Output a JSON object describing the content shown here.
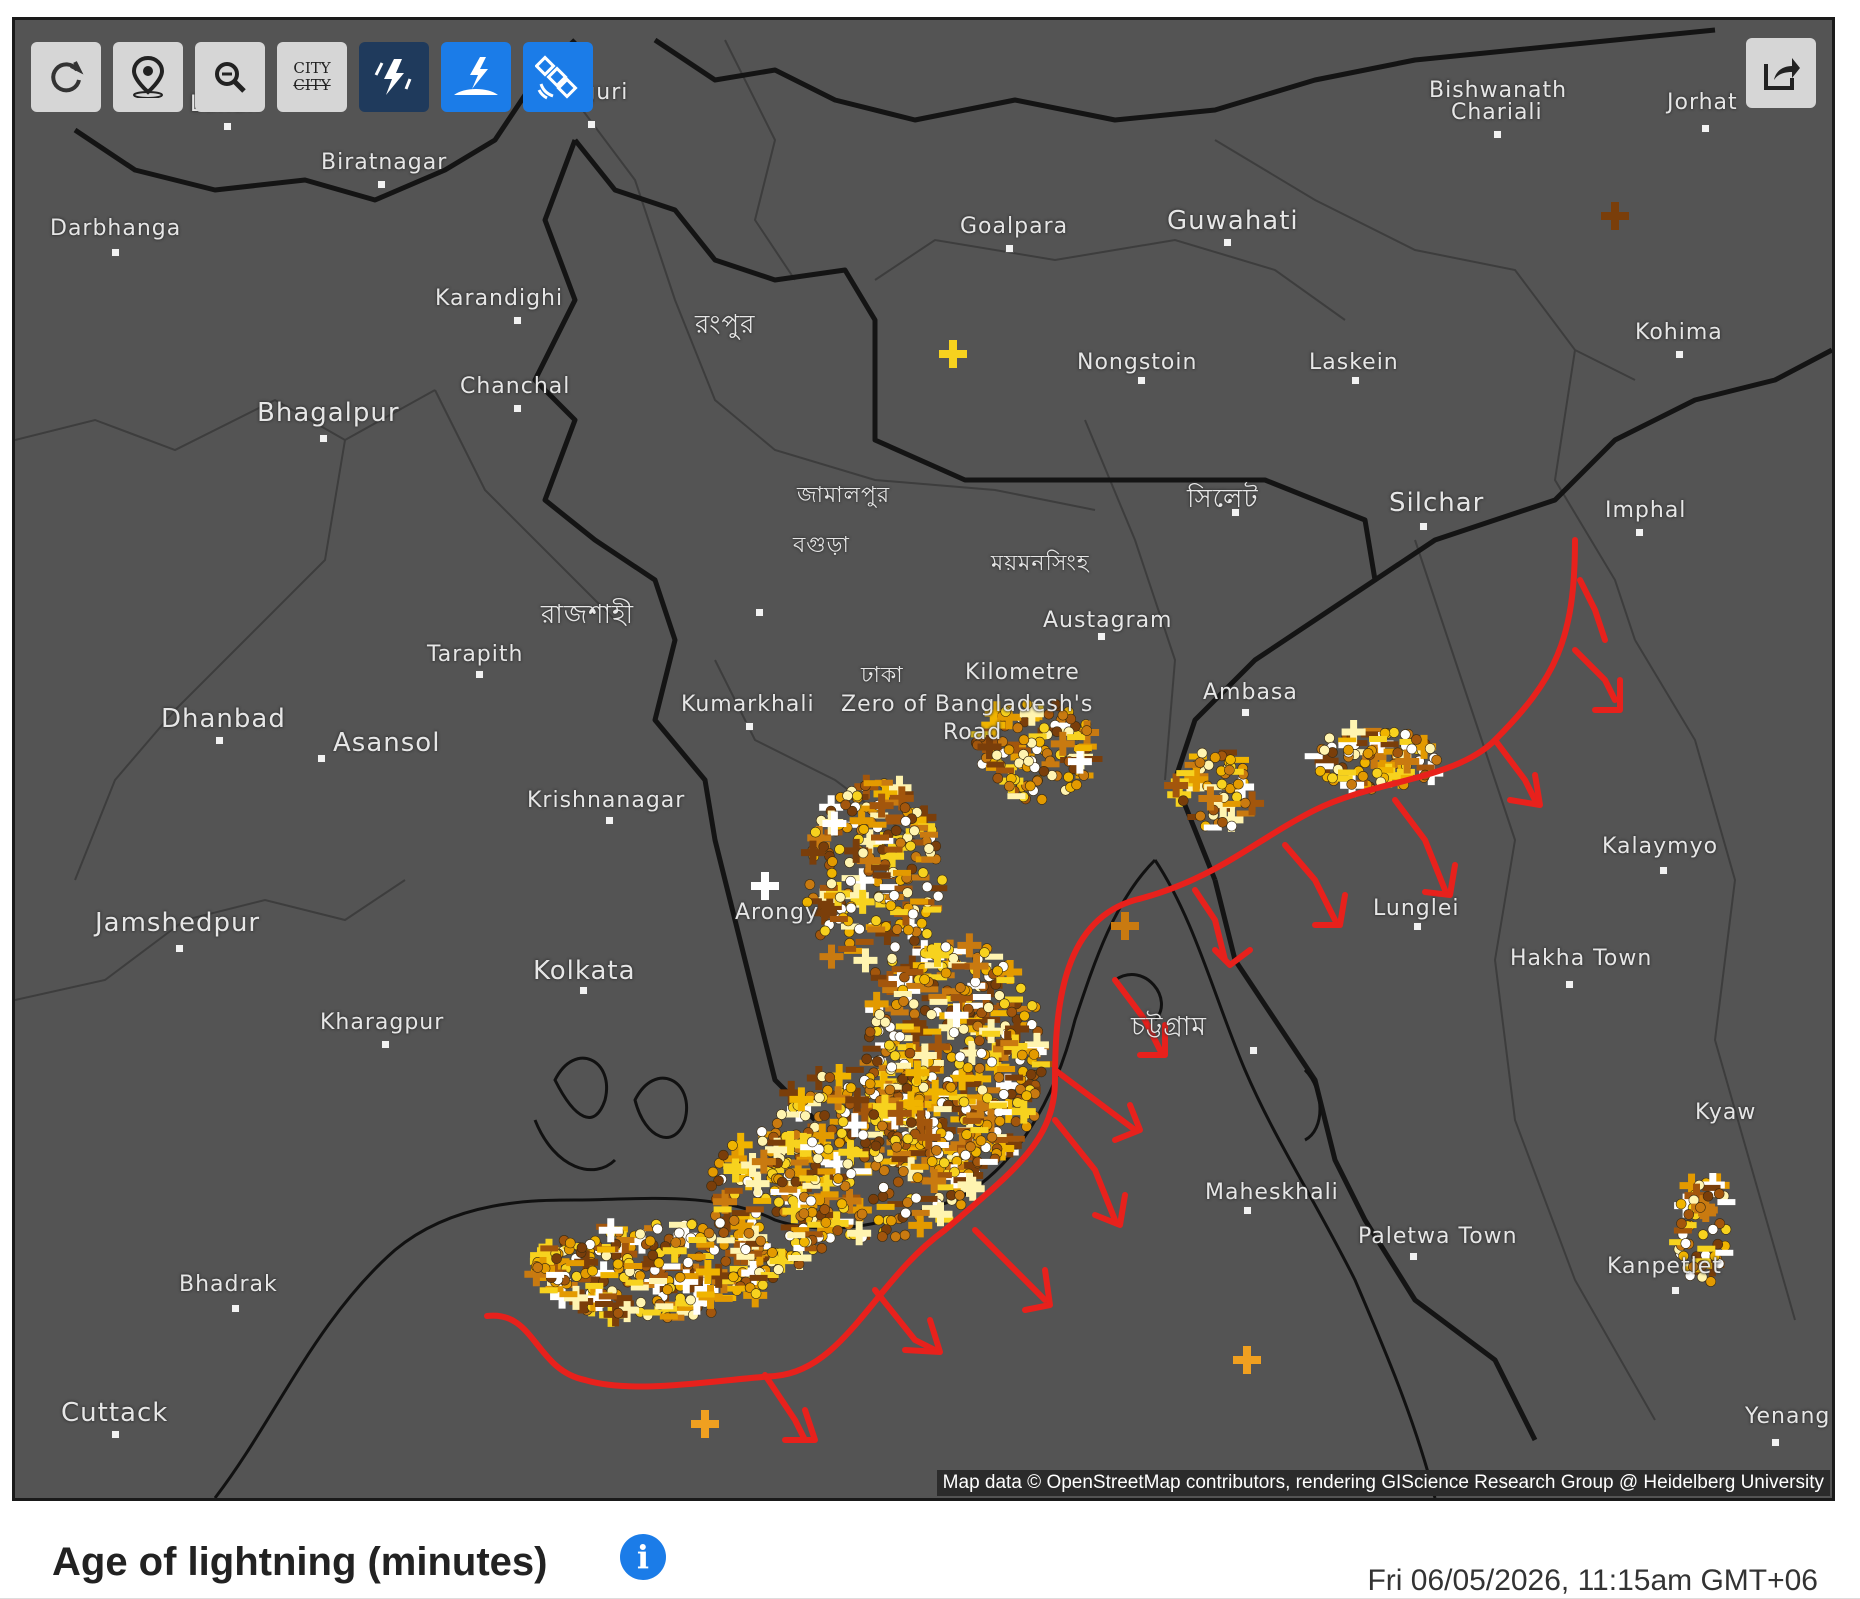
{
  "toolbar": {
    "buttons": [
      {
        "name": "refresh-icon"
      },
      {
        "name": "location-pin-icon"
      },
      {
        "name": "zoom-out-icon"
      },
      {
        "name": "city-toggle",
        "line1": "CITY",
        "line2": "CITY"
      },
      {
        "name": "lightning-icon"
      },
      {
        "name": "lightning-ground-icon"
      },
      {
        "name": "satellite-icon"
      }
    ],
    "share": "share-icon"
  },
  "map": {
    "labels": [
      {
        "text": "Siliguri"
      },
      {
        "text": "Lahan"
      },
      {
        "text": "Biratnagar"
      },
      {
        "text": "Darbhanga"
      },
      {
        "text": "Karandighi"
      },
      {
        "text": "Chanchal"
      },
      {
        "text": "Bhagalpur"
      },
      {
        "text": "Tarapith"
      },
      {
        "text": "Dhanbad"
      },
      {
        "text": "Asansol"
      },
      {
        "text": "Krishnanagar"
      },
      {
        "text": "Kumarkhali"
      },
      {
        "text": "Jamshedpur"
      },
      {
        "text": "Kolkata"
      },
      {
        "text": "Kharagpur"
      },
      {
        "text": "Bhadrak"
      },
      {
        "text": "Cuttack"
      },
      {
        "text": "Goalpara"
      },
      {
        "text": "Guwahati"
      },
      {
        "text": "Nongstoin"
      },
      {
        "text": "Laskein"
      },
      {
        "text": "Bishwanath"
      },
      {
        "text": "Chariali"
      },
      {
        "text": "Jorhat"
      },
      {
        "text": "Kohima"
      },
      {
        "text": "Silchar"
      },
      {
        "text": "Imphal"
      },
      {
        "text": "Austagram"
      },
      {
        "text": "Ambasa"
      },
      {
        "text": "Kalaymyo"
      },
      {
        "text": "Lunglei"
      },
      {
        "text": "Hakha Town"
      },
      {
        "text": "Maheskhali"
      },
      {
        "text": "Paletwa Town"
      },
      {
        "text": "Kanpetlet"
      },
      {
        "text": "Kyaw"
      },
      {
        "text": "Yenang"
      },
      {
        "text": "Arongy"
      },
      {
        "text": "Zero of Bangladesh's"
      },
      {
        "text": "Road"
      },
      {
        "text": "Kilometre"
      },
      {
        "text": "রংপুর"
      },
      {
        "text": "জামালপুর"
      },
      {
        "text": "বগুড়া"
      },
      {
        "text": "ময়মনসিংহ"
      },
      {
        "text": "রাজশাহী"
      },
      {
        "text": "সিলেট"
      },
      {
        "text": "ঢাকা"
      },
      {
        "text": "চট্টগ্রাম"
      }
    ],
    "attribution": "Map data © OpenStreetMap contributors, rendering GIScience Research Group @ Heidelberg University",
    "colors": {
      "background": "#545454",
      "lightning_new": "#ffffff",
      "lightning_mid": "#f2c200",
      "lightning_old": "#8a4a10",
      "annotation": "#e8211c"
    }
  },
  "legend": {
    "title": "Age of lightning (minutes)",
    "info_icon": "info-icon"
  },
  "timestamp": "Fri 06/05/2026, 11:15am GMT+06"
}
